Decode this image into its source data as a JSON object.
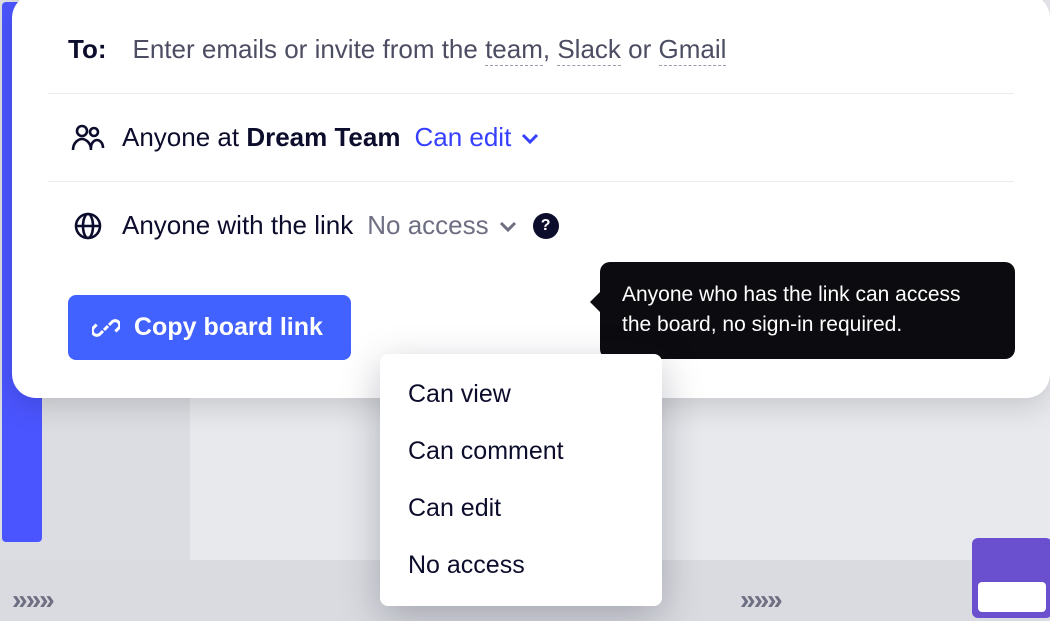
{
  "to": {
    "label": "To:",
    "placeholder_prefix": "Enter emails or invite from the ",
    "link_team": "team",
    "sep1": ", ",
    "link_slack": "Slack",
    "sep2": " or ",
    "link_gmail": "Gmail"
  },
  "team_row": {
    "prefix": "Anyone at ",
    "team_name": "Dream Team",
    "permission": "Can edit"
  },
  "link_row": {
    "label": "Anyone with the link",
    "permission": "No access",
    "help_symbol": "?",
    "tooltip": "Anyone who has the link can access the board, no sign-in required."
  },
  "permission_options": [
    "Can view",
    "Can comment",
    "Can edit",
    "No access"
  ],
  "copy_button": "Copy board link"
}
